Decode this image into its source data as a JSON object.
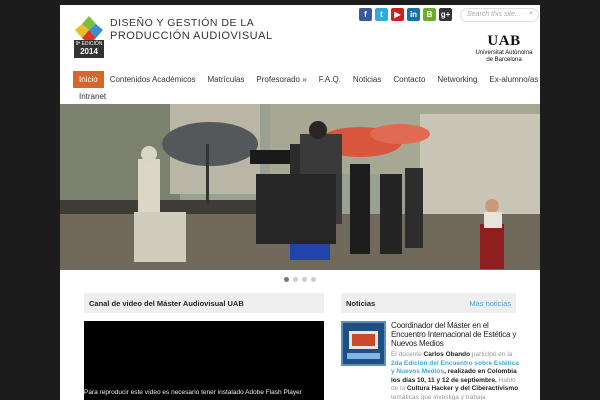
{
  "header": {
    "edition_line1": "9ª EDICIÓN",
    "edition_year": "2014",
    "title_line1": "DISEÑO Y GESTIÓN DE LA",
    "title_line2": "PRODUCCIÓN AUDIOVISUAL",
    "search_placeholder": "Search this site...",
    "search_icon": "magnifier",
    "social": [
      {
        "icon": "facebook-icon",
        "glyph": "f",
        "color": "#3b5998"
      },
      {
        "icon": "twitter-icon",
        "glyph": "t",
        "color": "#2fa9e0"
      },
      {
        "icon": "youtube-icon",
        "glyph": "▶",
        "color": "#cc2020"
      },
      {
        "icon": "linkedin-icon",
        "glyph": "in",
        "color": "#1a6fa3"
      },
      {
        "icon": "blogger-icon",
        "glyph": "B",
        "color": "#6cae2a"
      },
      {
        "icon": "googleplus-icon",
        "glyph": "g+",
        "color": "#333333"
      }
    ],
    "uab_mark": "UAB",
    "uab_name_line1": "Universitat Autònoma",
    "uab_name_line2": "de Barcelona"
  },
  "nav": {
    "row1": [
      "Inicio",
      "Contenidos Académicos",
      "Matrículas",
      "Profesorado »",
      "F.A.Q.",
      "Noticias",
      "Contacto",
      "Networking",
      "Ex-alumno/as »"
    ],
    "row2": [
      "Intranet"
    ],
    "active": "Inicio",
    "accent": "#d6672a"
  },
  "slider": {
    "dots": 4,
    "active_dot": 0
  },
  "video_widget": {
    "heading": "Canal de video del Máster Audiovisual UAB",
    "message": "Para reproducir este vídeo es necesario tener instalado Adobe Flash Player"
  },
  "news_widget": {
    "heading": "Noticias",
    "more_link": "Más noticias",
    "item_title": "Coordinador del Máster en el Encuentro Internacional de Estética y Nuevos Medios",
    "body_1": "El docente ",
    "body_2": "Carlos Obando",
    "body_3": " participó en la ",
    "body_4": "2da Edición del Encuentro sobre Estética y Nuevos Medios",
    "body_5": ", realizado en Colombia los días 10, 11 y 12 de septiembre.",
    "body_6": " Habló de la ",
    "body_7": "Cultura Hacker y del Ciberactivismo",
    "body_8": ", temáticas que investiga y trabaja"
  }
}
